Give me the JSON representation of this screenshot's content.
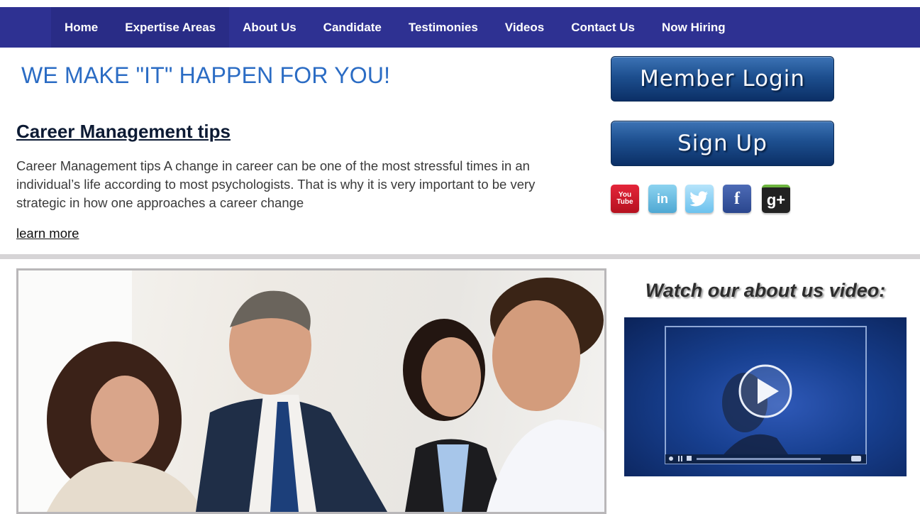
{
  "nav": {
    "items": [
      {
        "label": "Home"
      },
      {
        "label": "Expertise Areas"
      },
      {
        "label": "About Us"
      },
      {
        "label": "Candidate"
      },
      {
        "label": "Testimonies"
      },
      {
        "label": "Videos"
      },
      {
        "label": "Contact Us"
      },
      {
        "label": "Now Hiring"
      }
    ]
  },
  "hero": {
    "headline": "WE MAKE \"IT\" HAPPEN FOR YOU!"
  },
  "article": {
    "title": "Career Management tips",
    "body": "Career Management tips A change in career can be one of the most stressful times in an individual’s life according to most psychologists. That is why it is very important to be very strategic in how one approaches a career change",
    "link": "learn more"
  },
  "buttons": {
    "login": "Member Login",
    "signup": "Sign Up"
  },
  "social": {
    "youtube": "You Tube",
    "linkedin": "in",
    "facebook": "f",
    "gplus": "g+"
  },
  "video": {
    "heading": "Watch our about us video:"
  },
  "colors": {
    "nav_bg": "#2e3192",
    "headline": "#2b6cc4",
    "button": "#1d4f8f"
  }
}
